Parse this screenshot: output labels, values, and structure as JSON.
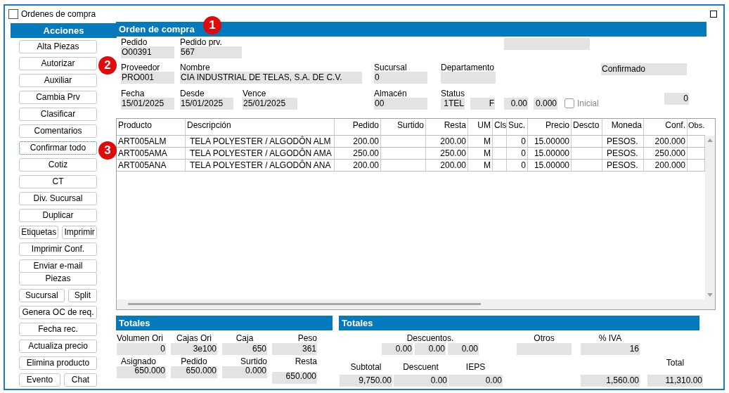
{
  "window": {
    "title": "Ordenes de compra"
  },
  "annotations": [
    {
      "number": "1"
    },
    {
      "number": "2"
    },
    {
      "number": "3"
    }
  ],
  "actions": {
    "title": "Acciones",
    "button_rows": [
      [
        {
          "label": "Alta Piezas",
          "focused": false
        }
      ],
      [
        {
          "label": "Autorizar",
          "focused": false
        }
      ],
      [
        {
          "label": "Auxiliar",
          "focused": false
        }
      ],
      [
        {
          "label": "Cambia Prv",
          "focused": false
        }
      ],
      [
        {
          "label": "Clasificar",
          "focused": false
        }
      ],
      [
        {
          "label": "Comentarios",
          "focused": false
        }
      ],
      [
        {
          "label": "Confirmar todo",
          "focused": true
        }
      ],
      [
        {
          "label": "Cotiz",
          "focused": false
        }
      ],
      [
        {
          "label": "CT",
          "focused": false
        }
      ],
      [
        {
          "label": "Div. Sucursal",
          "focused": false
        }
      ],
      [
        {
          "label": "Duplicar",
          "focused": false
        }
      ],
      [
        {
          "label": "Etiquetas",
          "focused": false
        },
        {
          "label": "Imprimir",
          "focused": false
        }
      ],
      [
        {
          "label": "Imprimir Conf.",
          "focused": false
        }
      ],
      [
        {
          "label": "Enviar e-mail",
          "focused": false
        }
      ],
      [
        {
          "label": "Piezas",
          "focused": false
        }
      ],
      [
        {
          "label": "Sucursal",
          "focused": false
        },
        {
          "label": "Split",
          "focused": false
        }
      ],
      [
        {
          "label": "Genera OC de req.",
          "focused": false
        }
      ],
      [
        {
          "label": "Fecha rec.",
          "focused": false
        }
      ],
      [
        {
          "label": "Actualiza precio",
          "focused": false
        }
      ],
      [
        {
          "label": "Elimina producto",
          "focused": false
        }
      ],
      [
        {
          "label": "Evento",
          "focused": false
        },
        {
          "label": "Chat",
          "focused": false
        }
      ]
    ]
  },
  "order": {
    "title": "Orden de compra",
    "fields": [
      {
        "kind": "field",
        "label": "Pedido",
        "value": "O00391"
      },
      {
        "kind": "field",
        "label": "Pedido prv.",
        "value": "567"
      },
      {
        "kind": "field"
      },
      {
        "kind": "field",
        "label": "Proveedor",
        "value": "PRO001"
      },
      {
        "kind": "field",
        "label": "Nombre",
        "value": "CIA INDUSTRIAL DE TELAS, S.A. DE C.V."
      },
      {
        "kind": "field",
        "label": "Sucursal",
        "value": "0"
      },
      {
        "kind": "field",
        "label": "Departamento"
      },
      {
        "kind": "field",
        "value": "Confirmado"
      },
      {
        "kind": "field",
        "label": "Fecha",
        "value": "15/01/2025"
      },
      {
        "kind": "field",
        "label": "Desde",
        "value": "15/01/2025"
      },
      {
        "kind": "field",
        "label": "Vence",
        "value": "25/01/2025"
      },
      {
        "kind": "field",
        "label": "Almacén",
        "value": "00"
      },
      {
        "kind": "field",
        "label": "Status",
        "value": "1TEL"
      },
      {
        "kind": "field",
        "value": "F"
      },
      {
        "kind": "field",
        "value": "0.00"
      },
      {
        "kind": "field",
        "value": "0.000"
      },
      {
        "kind": "checkbox",
        "label": "Inicial",
        "checked": false,
        "disabled": true
      },
      {
        "kind": "field",
        "value": "0"
      }
    ]
  },
  "table": {
    "columns": [
      "Producto",
      "Descripción",
      "Pedido",
      "Surtido",
      "Resta",
      "UM",
      "Cls",
      "Suc.",
      "Precio",
      "Descto",
      "Moneda",
      "Conf.",
      "Obs."
    ],
    "rows": [
      [
        "ART005ALM",
        "TELA POLYESTER / ALGODÔN ALM",
        "200.00",
        null,
        "200.00",
        "M",
        null,
        "0",
        "15.00000",
        null,
        "PESOS.",
        "200.000",
        null
      ],
      [
        "ART005AMA",
        "TELA POLYESTER / ALGODÔN AMA",
        "250.00",
        null,
        "250.00",
        "M",
        null,
        "0",
        "15.00000",
        null,
        "PESOS.",
        "250.000",
        null
      ],
      [
        "ART005ANA",
        "TELA POLYESTER / ALGODÔN ANA",
        "200.00",
        null,
        "200.00",
        "M",
        null,
        "0",
        "15.00000",
        null,
        "PESOS.",
        "200.000",
        null
      ]
    ]
  },
  "totals_left": {
    "title": "Totales",
    "fields": [
      {
        "label": "Volumen Ori",
        "value": "0"
      },
      {
        "label": "Cajas Ori",
        "value": "3e100"
      },
      {
        "label": "Caja",
        "value": "650"
      },
      {
        "label": "Peso",
        "value": "361"
      },
      {
        "label": "Asignado",
        "value": "650.000"
      },
      {
        "label": "Pedido",
        "value": "650.000"
      },
      {
        "label": "Surtido",
        "value": "0.000"
      },
      {
        "label": "Resta",
        "value": "650.000"
      }
    ]
  },
  "totals_right": {
    "title": "Totales",
    "discounts": {
      "label": "Descuentos.",
      "values": [
        "0.00",
        "0.00",
        "0.00"
      ]
    },
    "row1": [
      {
        "label": "Otros"
      },
      {
        "label": "% IVA",
        "value": "16"
      }
    ],
    "row2": [
      {
        "label": "Subtotal",
        "value": "9,750.00"
      },
      {
        "label": "Descuent",
        "value": "0.00"
      },
      {
        "label": "IEPS",
        "value": "0.00"
      },
      {
        "value": "1,560.00"
      },
      {
        "label": "Total",
        "value": "11,310.00"
      }
    ]
  }
}
